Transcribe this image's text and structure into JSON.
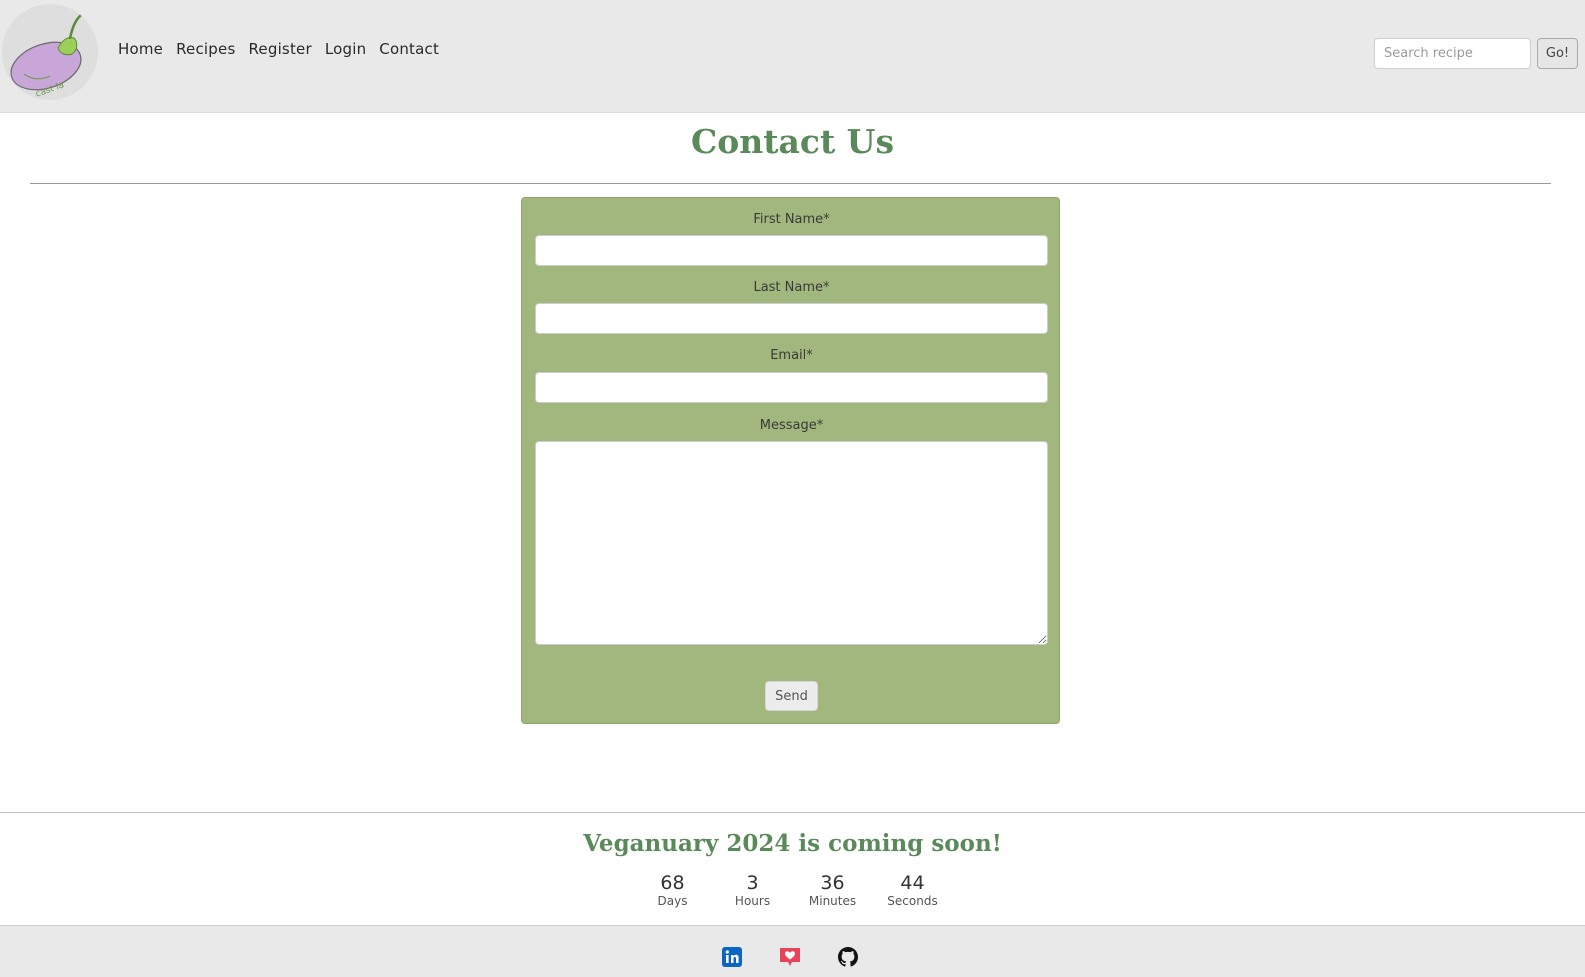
{
  "nav": {
    "logo_icon": "eggplant-logo-icon",
    "logo_text": "cast la",
    "links": [
      "Home",
      "Recipes",
      "Register",
      "Login",
      "Contact"
    ],
    "search_placeholder": "Search recipe",
    "search_button": "Go!"
  },
  "main": {
    "title": "Contact Us",
    "form": {
      "first_name_label": "First Name*",
      "last_name_label": "Last Name*",
      "email_label": "Email*",
      "message_label": "Message*",
      "send_label": "Send"
    }
  },
  "countdown": {
    "title": "Veganuary 2024 is coming soon!",
    "units": [
      {
        "value": "68",
        "label": "Days"
      },
      {
        "value": "3",
        "label": "Hours"
      },
      {
        "value": "36",
        "label": "Minutes"
      },
      {
        "value": "44",
        "label": "Seconds"
      }
    ]
  },
  "footer": {
    "icons": [
      "linkedin-icon",
      "heart-message-icon",
      "github-icon"
    ]
  },
  "colors": {
    "brand_green": "#5a8a5a",
    "form_background": "#a1b77d",
    "nav_background": "#e9e9e9",
    "linkedin_blue": "#0a66c2",
    "heart_red": "#e8435a"
  }
}
